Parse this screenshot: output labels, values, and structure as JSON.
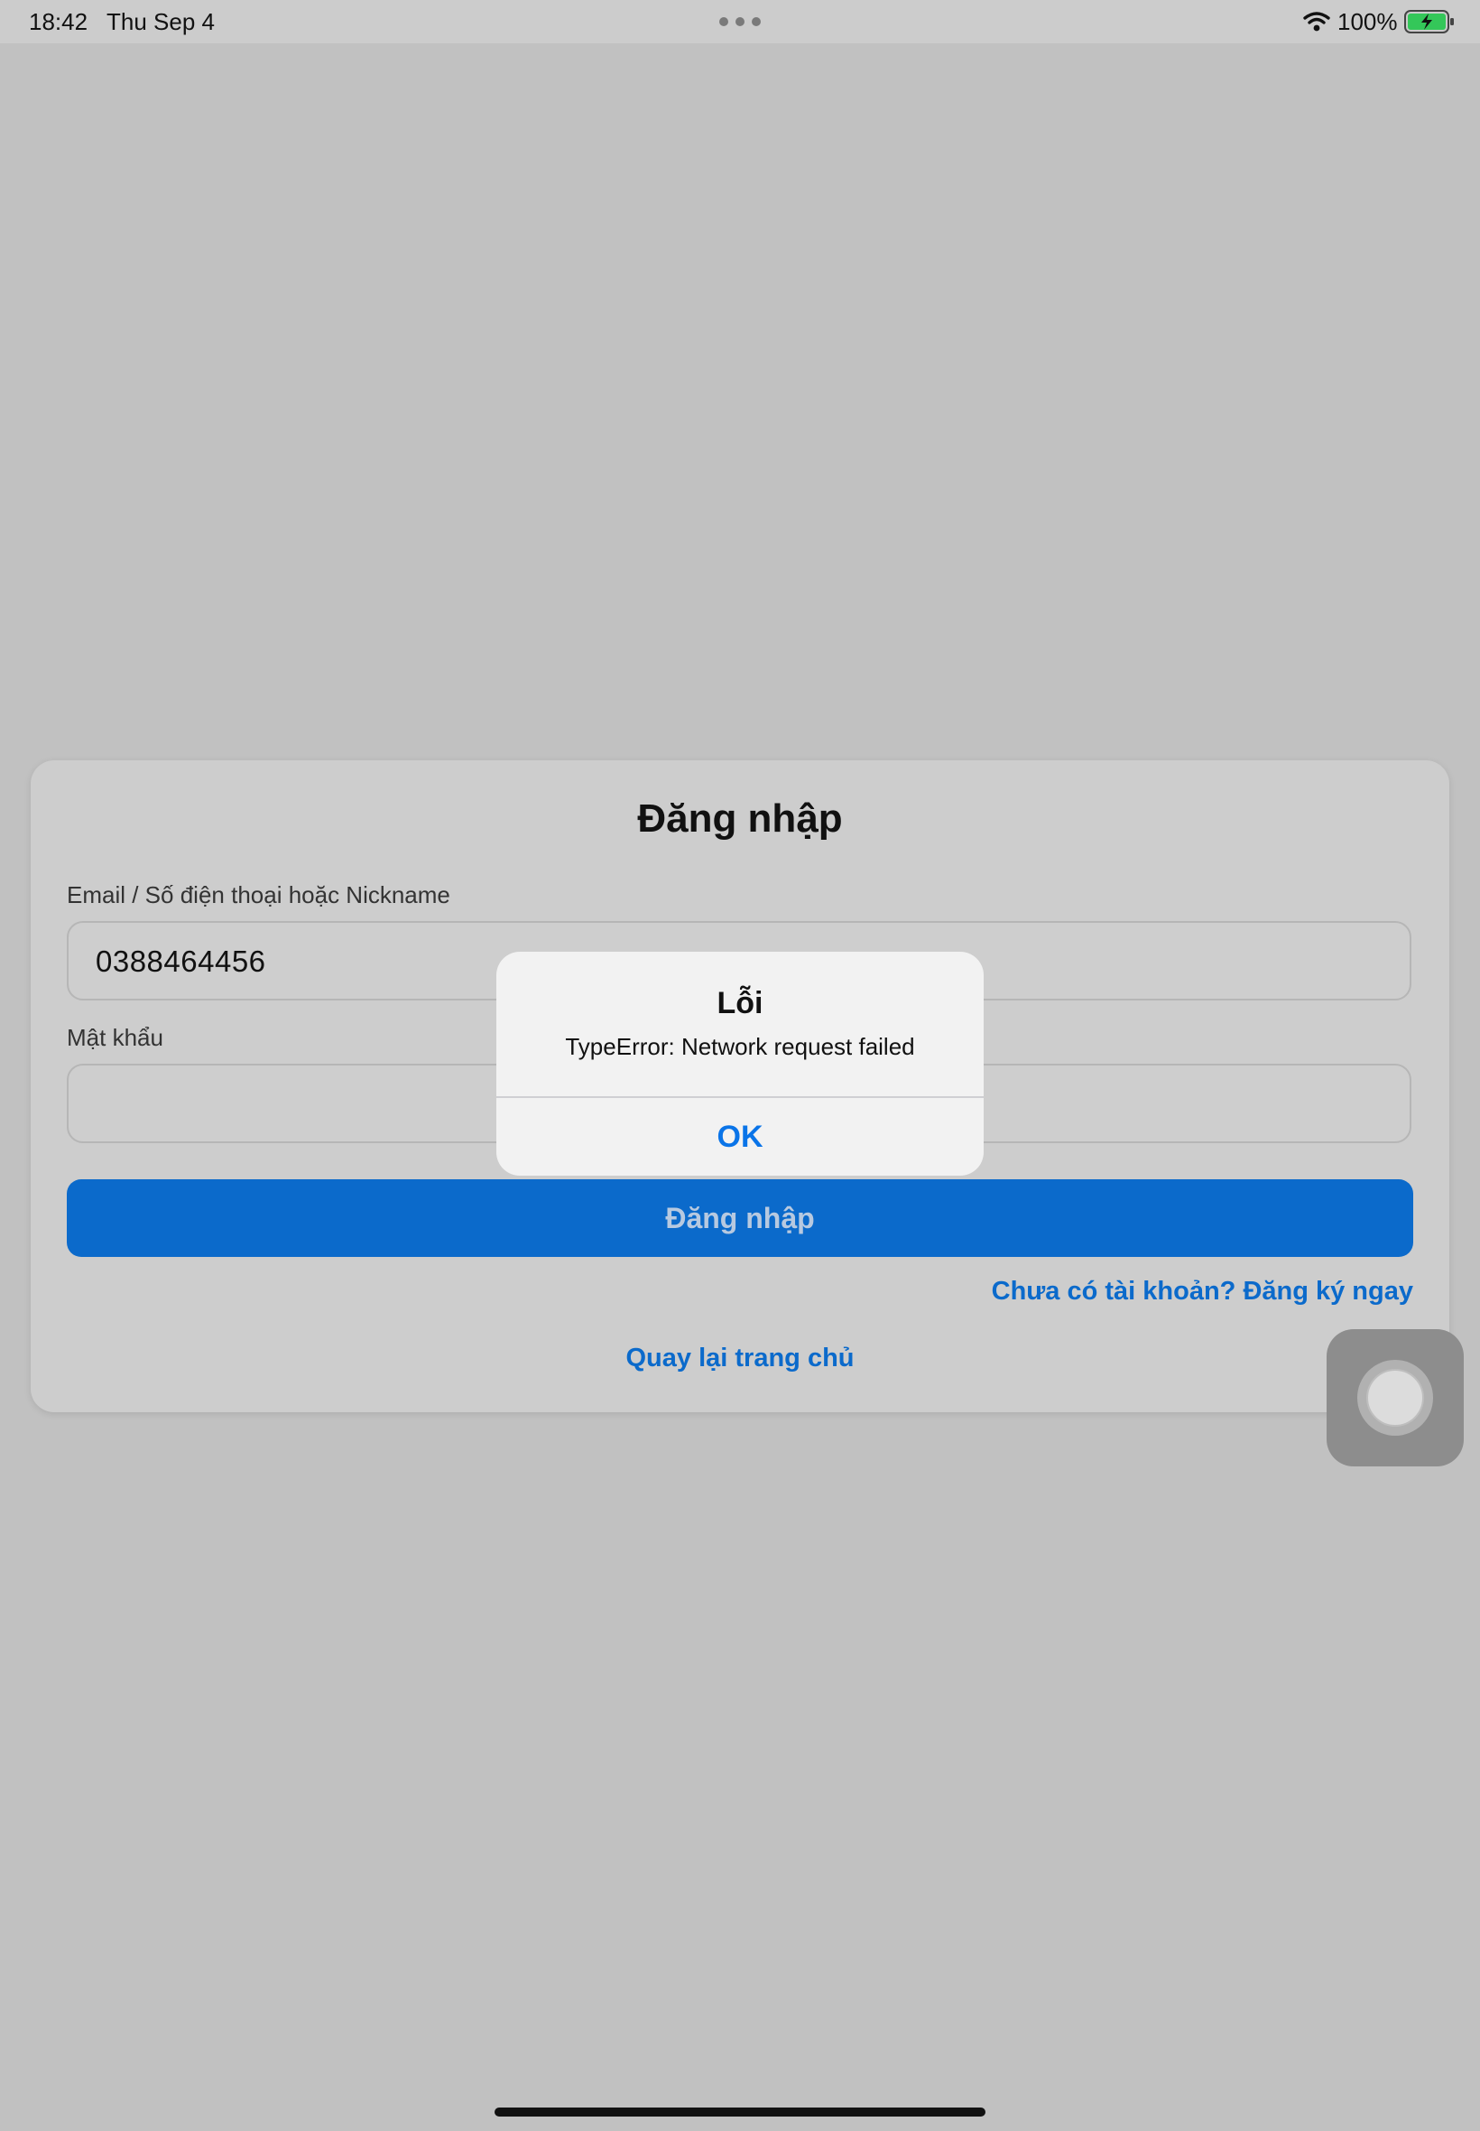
{
  "status_bar": {
    "time": "18:42",
    "date": "Thu Sep 4",
    "battery_percent": "100%",
    "wifi_icon": "wifi-icon",
    "battery_icon": "battery-charging-icon",
    "multitask_icon": "more-dots-icon"
  },
  "login": {
    "title": "Đăng nhập",
    "email_label": "Email / Số điện thoại hoặc Nickname",
    "email_value": "0388464456",
    "password_label": "Mật khẩu",
    "password_value": "",
    "login_button": "Đăng nhập",
    "register_link": "Chưa có tài khoản? Đăng ký ngay",
    "home_link": "Quay lại trang chủ"
  },
  "alert": {
    "title": "Lỗi",
    "message": "TypeError: Network request failed",
    "ok_label": "OK"
  },
  "colors": {
    "background": "#c1c1c1",
    "accent": "#0b6acb",
    "alert_button": "#0a74e8",
    "battery_fill": "#34c759"
  }
}
